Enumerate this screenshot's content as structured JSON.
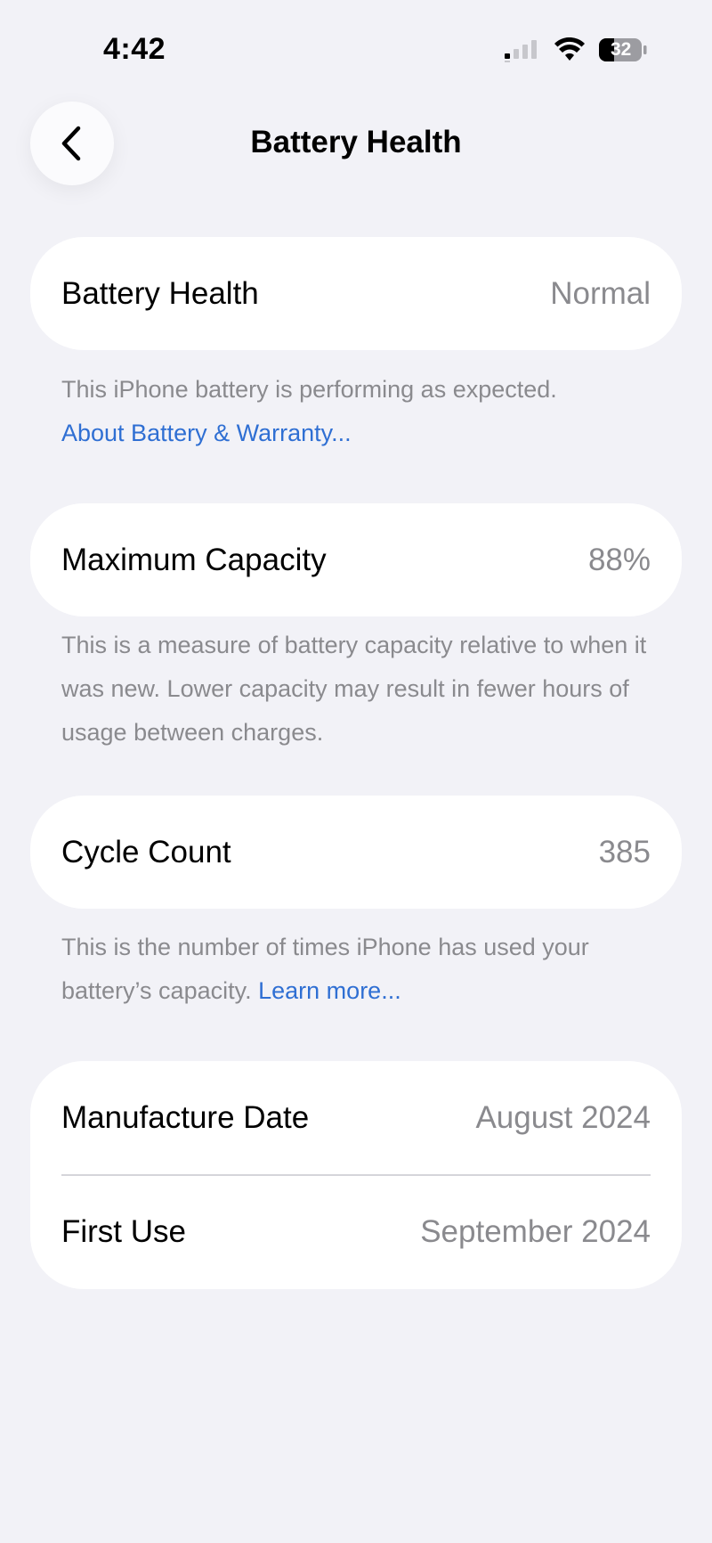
{
  "status_bar": {
    "time": "4:42",
    "battery_level": "32",
    "icons": [
      "cellular-signal-icon",
      "wifi-icon",
      "battery-icon"
    ]
  },
  "nav": {
    "back_icon": "chevron-left-icon",
    "title": "Battery Health"
  },
  "battery_health": {
    "label": "Battery Health",
    "value": "Normal",
    "description": "This iPhone battery is performing as expected.",
    "link": "About Battery & Warranty..."
  },
  "maximum_capacity": {
    "label": "Maximum Capacity",
    "value": "88%",
    "description": "This is a measure of battery capacity relative to when it was new. Lower capacity may result in fewer hours of usage between charges."
  },
  "cycle_count": {
    "label": "Cycle Count",
    "value": "385",
    "description": "This is the number of times iPhone has used your battery’s capacity.",
    "link": "Learn more..."
  },
  "dates": {
    "manufacture_label": "Manufacture Date",
    "manufacture_value": "August 2024",
    "first_use_label": "First Use",
    "first_use_value": "September 2024"
  },
  "colors": {
    "background": "#f2f2f7",
    "card": "#ffffff",
    "secondary_text": "#8a8a8e",
    "link": "#2f6fd3"
  }
}
